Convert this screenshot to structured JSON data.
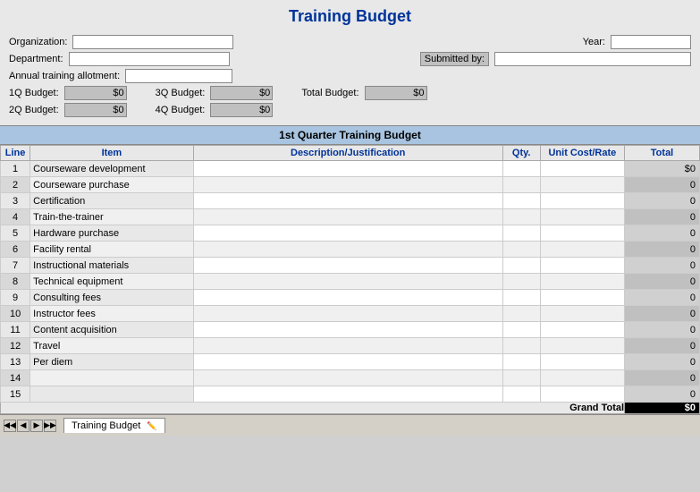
{
  "title": "Training Budget",
  "header": {
    "org_label": "Organization:",
    "year_label": "Year:",
    "dept_label": "Department:",
    "submitted_label": "Submitted by:",
    "allotment_label": "Annual training allotment:",
    "q1_label": "1Q Budget:",
    "q2_label": "2Q Budget:",
    "q3_label": "3Q Budget:",
    "q4_label": "4Q Budget:",
    "total_label": "Total Budget:",
    "q1_value": "$0",
    "q2_value": "$0",
    "q3_value": "$0",
    "q4_value": "$0",
    "total_value": "$0"
  },
  "quarter_header": "1st Quarter Training Budget",
  "columns": {
    "line": "Line",
    "item": "Item",
    "description": "Description/Justification",
    "qty": "Qty.",
    "unit_cost": "Unit Cost/Rate",
    "total": "Total"
  },
  "rows": [
    {
      "line": "1",
      "item": "Courseware development",
      "total": "$0",
      "alt": false
    },
    {
      "line": "2",
      "item": "Courseware purchase",
      "total": "0",
      "alt": true
    },
    {
      "line": "3",
      "item": "Certification",
      "total": "0",
      "alt": false
    },
    {
      "line": "4",
      "item": "Train-the-trainer",
      "total": "0",
      "alt": true
    },
    {
      "line": "5",
      "item": "Hardware purchase",
      "total": "0",
      "alt": false
    },
    {
      "line": "6",
      "item": "Facility rental",
      "total": "0",
      "alt": true
    },
    {
      "line": "7",
      "item": "Instructional materials",
      "total": "0",
      "alt": false
    },
    {
      "line": "8",
      "item": "Technical equipment",
      "total": "0",
      "alt": true
    },
    {
      "line": "9",
      "item": "Consulting fees",
      "total": "0",
      "alt": false
    },
    {
      "line": "10",
      "item": "Instructor fees",
      "total": "0",
      "alt": true
    },
    {
      "line": "11",
      "item": "Content acquisition",
      "total": "0",
      "alt": false
    },
    {
      "line": "12",
      "item": "Travel",
      "total": "0",
      "alt": true
    },
    {
      "line": "13",
      "item": "Per diem",
      "total": "0",
      "alt": false
    },
    {
      "line": "14",
      "item": "",
      "total": "0",
      "alt": true
    },
    {
      "line": "15",
      "item": "",
      "total": "0",
      "alt": false
    }
  ],
  "grand_total_label": "Grand Total",
  "grand_total_value": "$0",
  "taskbar": {
    "tab_label": "Training Budget"
  }
}
